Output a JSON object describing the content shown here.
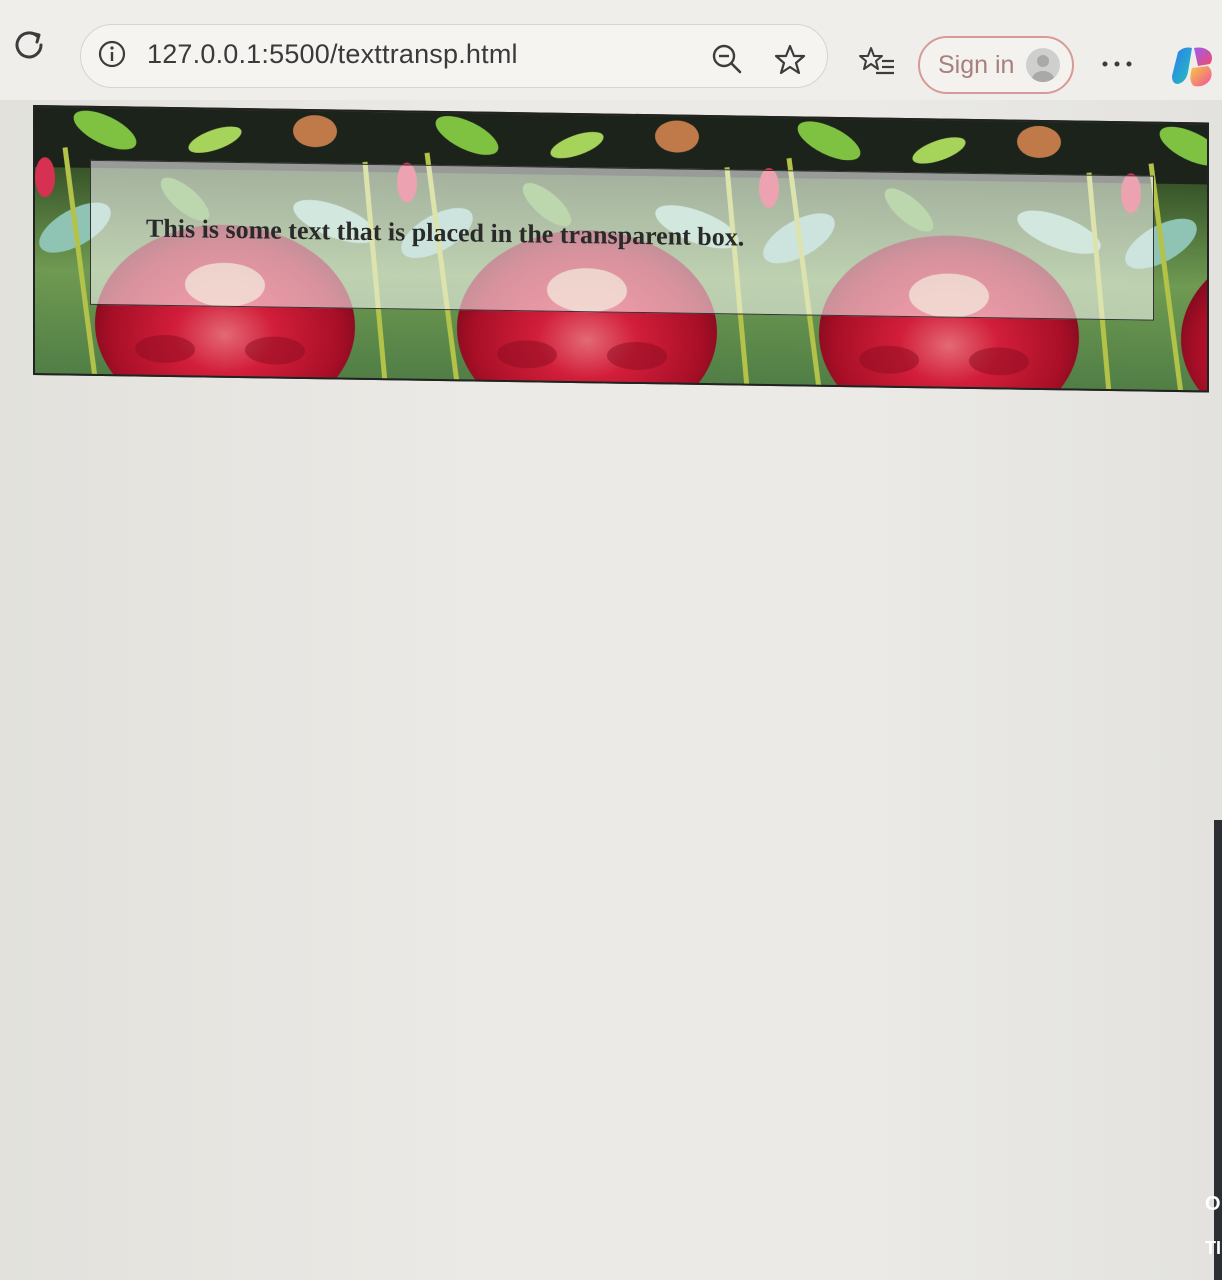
{
  "browser": {
    "url": "127.0.0.1:5500/texttransp.html",
    "sign_in_label": "Sign in",
    "icons": {
      "reload": "reload-icon",
      "site_info": "info-icon",
      "zoom": "zoom-out-icon",
      "favorite": "star-icon",
      "favorites_list": "favorites-icon",
      "profile": "avatar-icon",
      "more": "more-icon",
      "copilot": "copilot-icon"
    }
  },
  "page": {
    "transbox_text": "This is some text that is placed in the transparent box."
  },
  "edge_fragments": [
    "O",
    "TI"
  ]
}
